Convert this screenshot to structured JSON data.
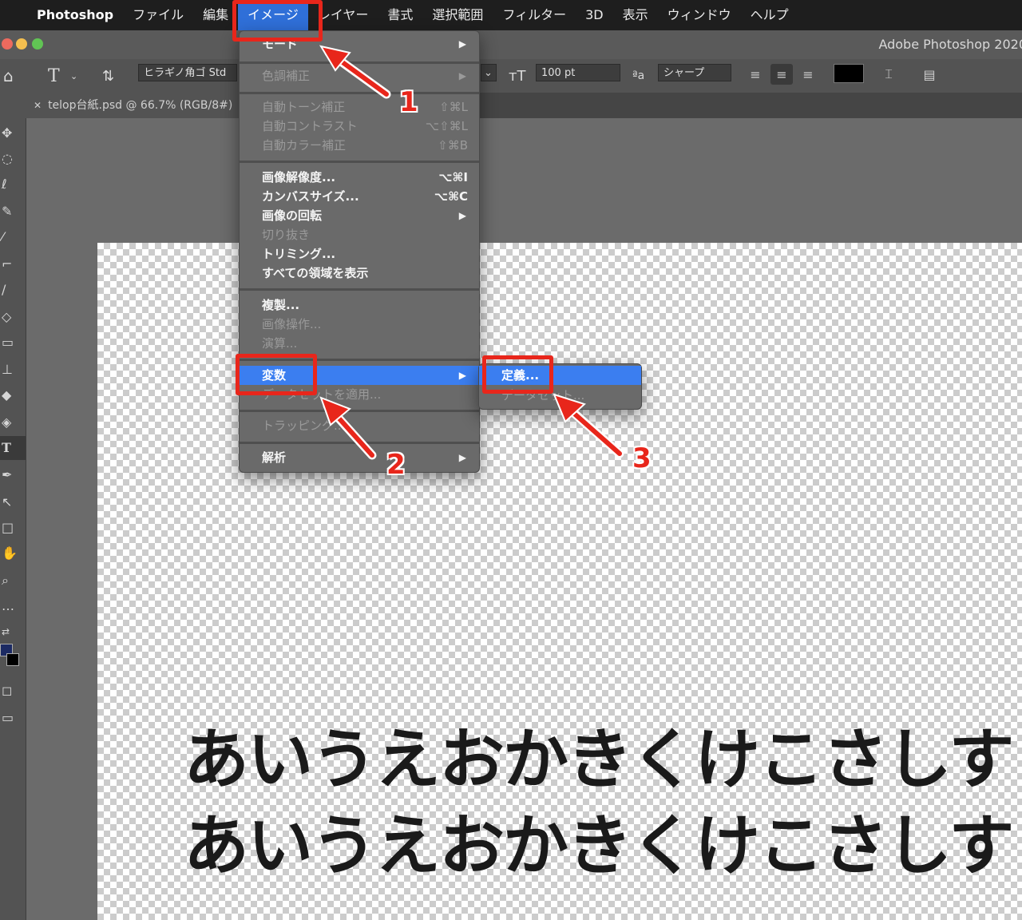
{
  "menubar": {
    "app": "Photoshop",
    "items": [
      "ファイル",
      "編集",
      "イメージ",
      "レイヤー",
      "書式",
      "選択範囲",
      "フィルター",
      "3D",
      "表示",
      "ウィンドウ",
      "ヘルプ"
    ],
    "active": "イメージ"
  },
  "window": {
    "title": "Adobe Photoshop 2020"
  },
  "options": {
    "font_family": "ヒラギノ角ゴ Std",
    "font_size": "100 pt",
    "aa_label": "ªa",
    "antialias": "シャープ",
    "text_color": "#000000"
  },
  "document": {
    "tab_title": "telop台紙.psd @ 66.7% (RGB/8#)"
  },
  "image_menu": {
    "items": [
      {
        "label": "モード",
        "disabled": false,
        "submenu": true
      },
      {
        "label": "色調補正",
        "disabled": true,
        "submenu": true
      },
      {
        "label": "自動トーン補正",
        "shortcut": "⇧⌘L",
        "disabled": true
      },
      {
        "label": "自動コントラスト",
        "shortcut": "⌥⇧⌘L",
        "disabled": true
      },
      {
        "label": "自動カラー補正",
        "shortcut": "⇧⌘B",
        "disabled": true
      },
      {
        "label": "画像解像度...",
        "shortcut": "⌥⌘I",
        "disabled": false
      },
      {
        "label": "カンバスサイズ...",
        "shortcut": "⌥⌘C",
        "disabled": false
      },
      {
        "label": "画像の回転",
        "disabled": false,
        "submenu": true
      },
      {
        "label": "切り抜き",
        "disabled": true
      },
      {
        "label": "トリミング...",
        "disabled": false
      },
      {
        "label": "すべての領域を表示",
        "disabled": false
      },
      {
        "label": "複製...",
        "disabled": false
      },
      {
        "label": "画像操作...",
        "disabled": true
      },
      {
        "label": "演算...",
        "disabled": true
      },
      {
        "label": "変数",
        "disabled": false,
        "submenu": true,
        "highlighted": true
      },
      {
        "label": "データセットを適用...",
        "disabled": true
      },
      {
        "label": "トラッピング...",
        "disabled": true
      },
      {
        "label": "解析",
        "disabled": false,
        "submenu": true
      }
    ]
  },
  "variables_submenu": {
    "items": [
      {
        "label": "定義...",
        "highlighted": true
      },
      {
        "label": "データセット...",
        "disabled": true
      }
    ]
  },
  "canvas": {
    "line1": "あいうえおかきくけこさしす",
    "line2": "あいうえおかきくけこさしす"
  },
  "annotations": {
    "step1": "1",
    "step2": "2",
    "step3": "3",
    "color": "#e8261b"
  }
}
